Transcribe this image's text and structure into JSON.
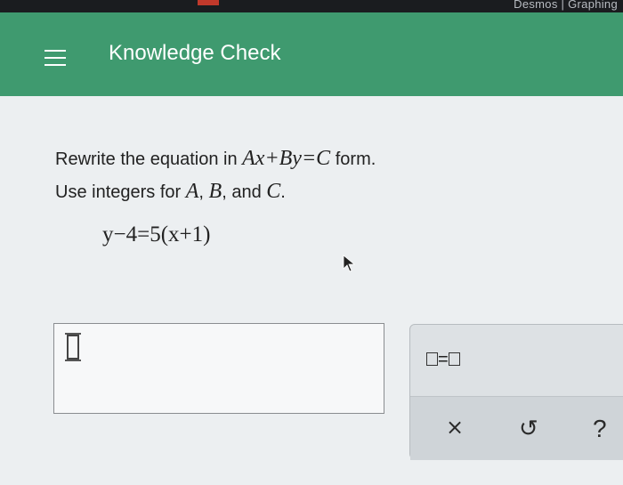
{
  "browser": {
    "tab_text": "Desmos | Graphing"
  },
  "header": {
    "title": "Knowledge Check",
    "bg_color": "#3f9a6f"
  },
  "question": {
    "line1_text": "Rewrite the equation in ",
    "line1_math": "Ax+By=C",
    "line1_suffix": " form.",
    "line2_text": "Use integers for ",
    "line2_var_a": "A",
    "line2_comma1": ", ",
    "line2_var_b": "B",
    "line2_and": ", and ",
    "line2_var_c": "C",
    "line2_period": ".",
    "equation": "y−4=5(x+1)"
  },
  "tools": {
    "equals_label": "=",
    "clear_icon": "×",
    "undo_icon": "↺",
    "help_icon": "?"
  },
  "icons": [
    "menu-icon",
    "cursor-arrow-icon",
    "placeholder-box-icon",
    "clear-icon",
    "undo-icon",
    "help-icon"
  ]
}
